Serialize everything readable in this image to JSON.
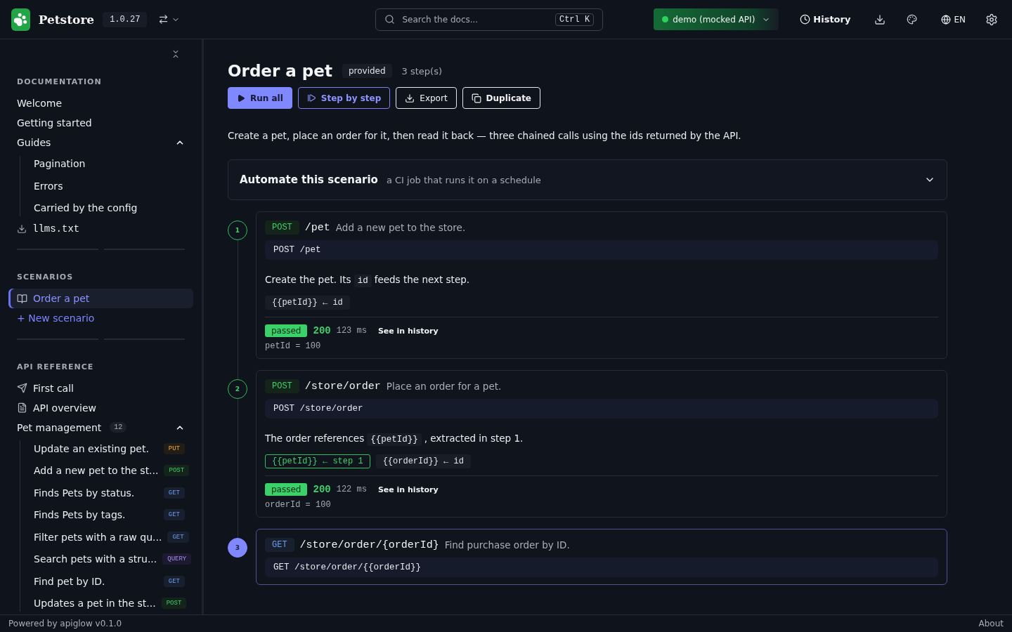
{
  "topbar": {
    "brand": "Petstore",
    "version": "1.0.27",
    "search": {
      "placeholder": "Search the docs...",
      "shortcut": "Ctrl K"
    },
    "environment": {
      "label": "demo (mocked API)",
      "online": true
    },
    "history": "History",
    "language": "EN"
  },
  "sidebar": {
    "sections": [
      {
        "title": "DOCUMENTATION",
        "items": [
          {
            "kind": "link",
            "label": "Welcome"
          },
          {
            "kind": "link",
            "label": "Getting started"
          },
          {
            "kind": "group",
            "label": "Guides",
            "expanded": true,
            "children": [
              {
                "kind": "link",
                "label": "Pagination"
              },
              {
                "kind": "link",
                "label": "Errors"
              },
              {
                "kind": "link",
                "label": "Carried by the config"
              }
            ]
          },
          {
            "kind": "file",
            "label": "llms.txt"
          }
        ]
      },
      {
        "title": "SCENARIOS",
        "items": [
          {
            "kind": "scenario",
            "label": "Order a pet",
            "selected": true
          },
          {
            "kind": "add",
            "label": "+ New scenario"
          }
        ]
      },
      {
        "title": "API REFERENCE",
        "items": [
          {
            "kind": "send",
            "label": "First call"
          },
          {
            "kind": "doc",
            "label": "API overview"
          },
          {
            "kind": "group",
            "label": "Pet management",
            "count": "12",
            "expanded": true,
            "children": [
              {
                "kind": "endpoint",
                "label": "Update an existing pet.",
                "method": "PUT"
              },
              {
                "kind": "endpoint",
                "label": "Add a new pet to the st...",
                "method": "POST"
              },
              {
                "kind": "endpoint",
                "label": "Finds Pets by status.",
                "method": "GET"
              },
              {
                "kind": "endpoint",
                "label": "Finds Pets by tags.",
                "method": "GET"
              },
              {
                "kind": "endpoint",
                "label": "Filter pets with a raw qu...",
                "method": "GET"
              },
              {
                "kind": "endpoint",
                "label": "Search pets with a stru...",
                "method": "QUERY"
              },
              {
                "kind": "endpoint",
                "label": "Find pet by ID.",
                "method": "GET"
              },
              {
                "kind": "endpoint",
                "label": "Updates a pet in the st...",
                "method": "POST"
              }
            ]
          }
        ]
      }
    ]
  },
  "scenario": {
    "title": "Order a pet",
    "badge": "provided",
    "steps_count": "3 step(s)",
    "actions": [
      {
        "kind": "run",
        "label": "Run all"
      },
      {
        "kind": "step",
        "label": "Step by step"
      },
      {
        "kind": "export",
        "label": "Export"
      },
      {
        "kind": "duplicate",
        "label": "Duplicate"
      }
    ],
    "description": "Create a pet, place an order for it, then read it back — three chained calls using the ids returned by the API.",
    "automate": {
      "title": "Automate this scenario",
      "subtitle": "a CI job that runs it on a schedule",
      "expanded": false
    },
    "steps": [
      {
        "number": "1",
        "active": false,
        "method": "POST",
        "path": "/pet",
        "summary": "Add a new pet to the store.",
        "request": "POST /pet",
        "note": [
          {
            "text": "Create the pet. Its"
          },
          {
            "code": "id"
          },
          {
            "text": "feeds the next step."
          }
        ],
        "variables": [
          {
            "kind": "output",
            "label": "{{petId}} ← id"
          }
        ],
        "result": {
          "status": "passed",
          "code": "200",
          "time": "123 ms",
          "link": "See in history",
          "output": "petId = 100"
        }
      },
      {
        "number": "2",
        "active": false,
        "method": "POST",
        "path": "/store/order",
        "summary": "Place an order for a pet.",
        "request": "POST /store/order",
        "note": [
          {
            "text": "The order references"
          },
          {
            "code": "{{petId}}"
          },
          {
            "text": ", extracted in step 1."
          }
        ],
        "variables": [
          {
            "kind": "input",
            "label": "{{petId}} ← step 1"
          },
          {
            "kind": "output",
            "label": "{{orderId}} ← id"
          }
        ],
        "result": {
          "status": "passed",
          "code": "200",
          "time": "122 ms",
          "link": "See in history",
          "output": "orderId = 100"
        }
      },
      {
        "number": "3",
        "active": true,
        "method": "GET",
        "path": "/store/order/{orderId}",
        "summary": "Find purchase order by ID.",
        "request": "GET /store/order/{{orderId}}"
      }
    ]
  },
  "footer": {
    "powered": "Powered by apiglow v0.1.0",
    "about": "About"
  }
}
